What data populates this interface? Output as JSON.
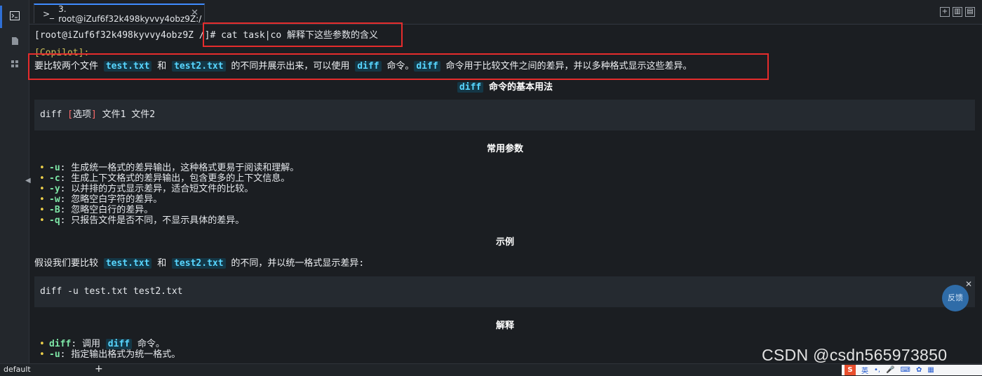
{
  "tab": {
    "title": "3. root@iZuf6f32k498kyvvy4obz9Z:/",
    "icon": "terminal-icon"
  },
  "terminal": {
    "prompt_user": "[root@iZuf6f32k498kyvvy4obz9Z /]",
    "prompt_hash": "#",
    "command": "cat task|co 解释下这些参数的含义",
    "copilot_label": "[Copilot]:",
    "intro": {
      "p1": "要比较两个文件 ",
      "c1": "test.txt",
      "p2": " 和 ",
      "c2": "test2.txt",
      "p3": " 的不同并展示出来，可以使用 ",
      "c3": "diff",
      "p4": " 命令。",
      "c4": "diff",
      "p5": " 命令用于比较文件之间的差异，并以多种格式显示这些差异。"
    },
    "section1": {
      "code": "diff",
      "title": " 命令的基本用法"
    },
    "usage": {
      "cmd": "diff ",
      "bracket_open": "[",
      "opt": "选项",
      "bracket_close": "]",
      "rest": " 文件1 文件2"
    },
    "section2": "常用参数",
    "params": [
      {
        "flag": "-u",
        "desc": ": 生成统一格式的差异输出，这种格式更易于阅读和理解。"
      },
      {
        "flag": "-c",
        "desc": ": 生成上下文格式的差异输出，包含更多的上下文信息。"
      },
      {
        "flag": "-y",
        "desc": ": 以并排的方式显示差异，适合短文件的比较。"
      },
      {
        "flag": "-w",
        "desc": ": 忽略空白字符的差异。"
      },
      {
        "flag": "-B",
        "desc": ": 忽略空白行的差异。"
      },
      {
        "flag": "-q",
        "desc": ": 只报告文件是否不同，不显示具体的差异。"
      }
    ],
    "section3": "示例",
    "example": {
      "p1": "假设我们要比较 ",
      "c1": "test.txt",
      "p2": " 和 ",
      "c2": "test2.txt",
      "p3": " 的不同，并以统一格式显示差异:"
    },
    "example_cmd": "diff -u test.txt test2.txt",
    "section4": "解释",
    "explain": [
      {
        "code": "diff",
        "p1": ": 调用 ",
        "code2": "diff",
        "p2": " 命令。"
      },
      {
        "code": "-u",
        "p1": ": 指定输出格式为统一格式。"
      }
    ]
  },
  "feedback": "反馈",
  "status": {
    "session": "default",
    "add": "+"
  },
  "watermark": "CSDN @csdn565973850",
  "ime": {
    "logo": "S",
    "label": "英"
  }
}
